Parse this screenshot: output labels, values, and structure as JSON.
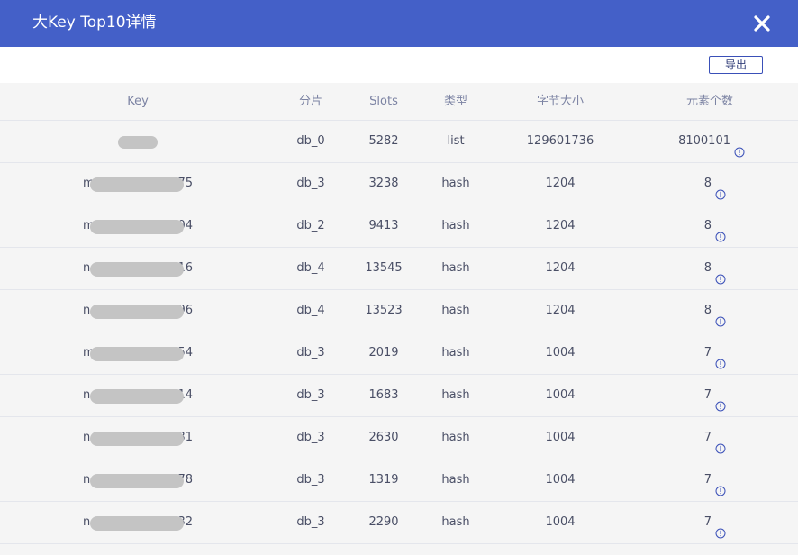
{
  "dialog": {
    "title": "大Key Top10详情",
    "export_label": "导出"
  },
  "colors": {
    "header_bg": "#4460c8",
    "accent": "#3a50b8",
    "row_bg": "#f5f5f5"
  },
  "table": {
    "columns": {
      "key": "Key",
      "shard": "分片",
      "slots": "Slots",
      "type": "类型",
      "bytes": "字节大小",
      "elements": "元素个数"
    },
    "rows": [
      {
        "key_prefix": "",
        "key_suffix": "",
        "shard": "db_0",
        "slots": "5282",
        "type": "list",
        "bytes": "129601736",
        "elements": "8100101"
      },
      {
        "key_prefix": "m",
        "key_suffix": "75",
        "shard": "db_3",
        "slots": "3238",
        "type": "hash",
        "bytes": "1204",
        "elements": "8"
      },
      {
        "key_prefix": "m",
        "key_suffix": "04",
        "shard": "db_2",
        "slots": "9413",
        "type": "hash",
        "bytes": "1204",
        "elements": "8"
      },
      {
        "key_prefix": "n",
        "key_suffix": "16",
        "shard": "db_4",
        "slots": "13545",
        "type": "hash",
        "bytes": "1204",
        "elements": "8"
      },
      {
        "key_prefix": "n",
        "key_suffix": "96",
        "shard": "db_4",
        "slots": "13523",
        "type": "hash",
        "bytes": "1204",
        "elements": "8"
      },
      {
        "key_prefix": "m",
        "key_suffix": "54",
        "shard": "db_3",
        "slots": "2019",
        "type": "hash",
        "bytes": "1004",
        "elements": "7"
      },
      {
        "key_prefix": "n",
        "key_suffix": "14",
        "shard": "db_3",
        "slots": "1683",
        "type": "hash",
        "bytes": "1004",
        "elements": "7"
      },
      {
        "key_prefix": "n",
        "key_suffix": "31",
        "shard": "db_3",
        "slots": "2630",
        "type": "hash",
        "bytes": "1004",
        "elements": "7"
      },
      {
        "key_prefix": "n",
        "key_suffix": "78",
        "shard": "db_3",
        "slots": "1319",
        "type": "hash",
        "bytes": "1004",
        "elements": "7"
      },
      {
        "key_prefix": "n",
        "key_suffix": "32",
        "shard": "db_3",
        "slots": "2290",
        "type": "hash",
        "bytes": "1004",
        "elements": "7"
      }
    ]
  }
}
